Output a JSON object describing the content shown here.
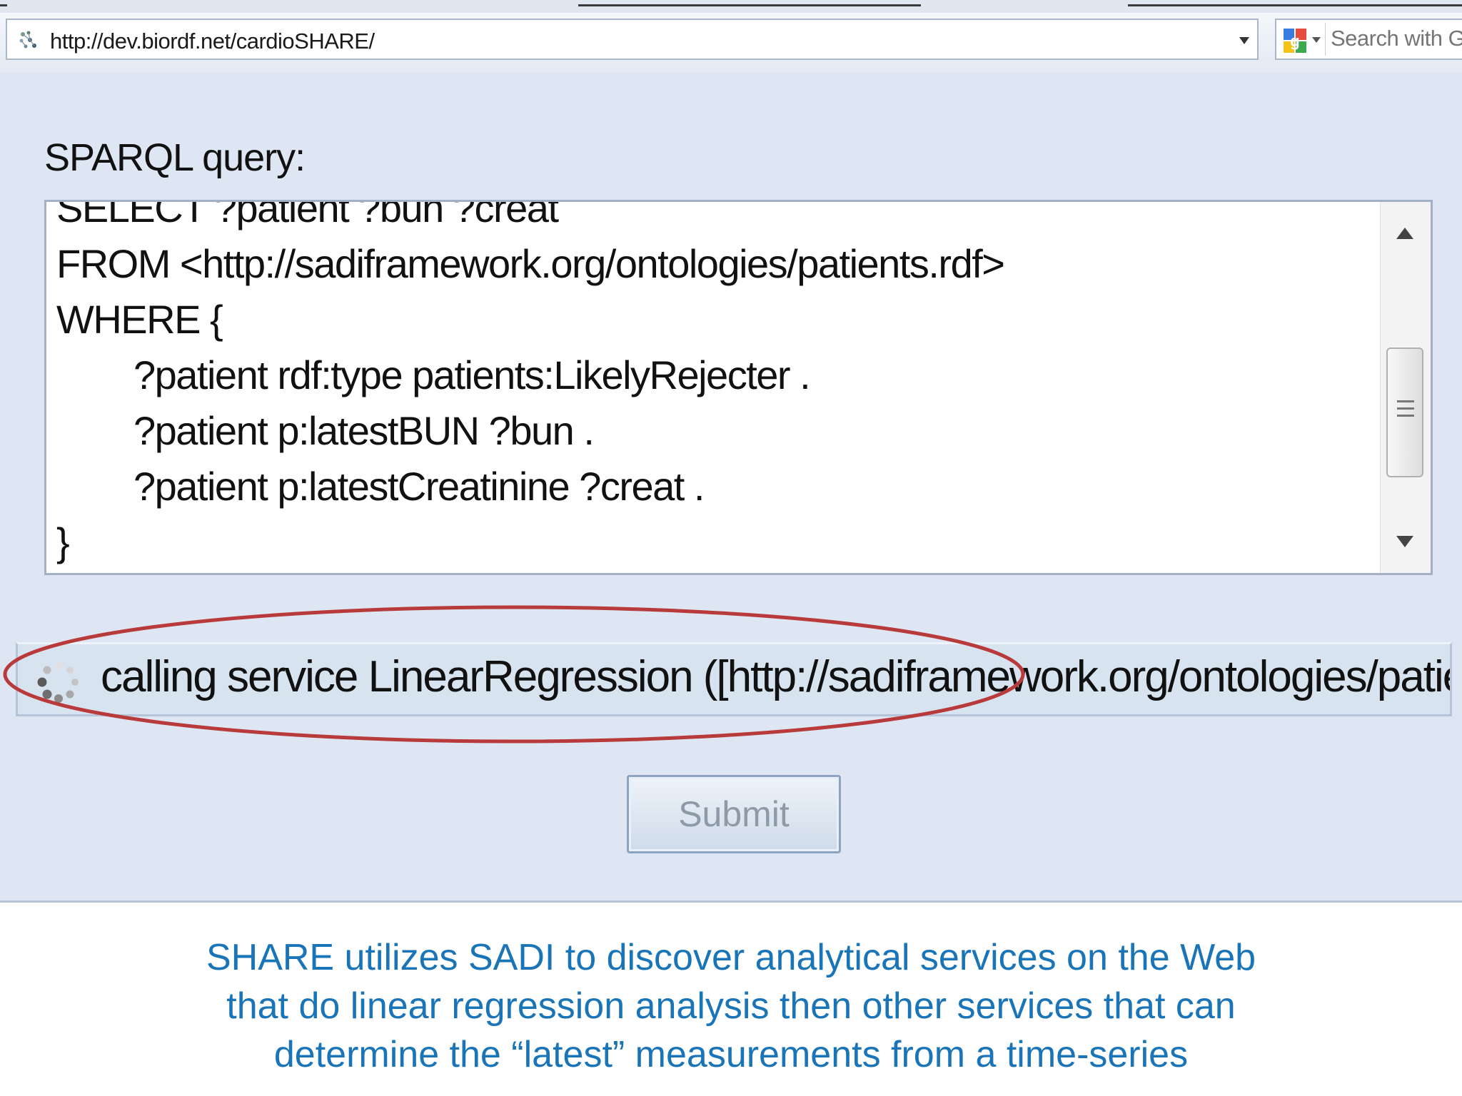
{
  "browser": {
    "url": "http://dev.biordf.net/cardioSHARE/",
    "search_placeholder": "Search with Goo"
  },
  "form": {
    "query_label": "SPARQL query:",
    "query_lines": [
      "SELECT ?patient ?bun ?creat",
      "FROM <http://sadiframework.org/ontologies/patients.rdf>",
      "WHERE {",
      "?patient rdf:type patients:LikelyRejecter .",
      "?patient p:latestBUN ?bun .",
      "?patient p:latestCreatinine ?creat .",
      "}"
    ],
    "status_text": "calling service LinearRegression ([http://sadiframework.org/ontologies/patients.rdf",
    "submit_label": "Submit"
  },
  "caption": {
    "line1": "SHARE utilizes SADI to discover analytical services on the Web",
    "line2": "that do linear regression analysis then other services that can",
    "line3": "determine the “latest” measurements from a time-series"
  },
  "colors": {
    "caption": "#1a74b8",
    "highlight_ellipse": "#b83a3a",
    "panel_background": "#dde6f2"
  },
  "icons": [
    "site-favicon-icon",
    "dropdown-arrow-icon",
    "google-search-icon",
    "loading-spinner-icon",
    "scroll-up-arrow-icon",
    "scroll-down-arrow-icon"
  ]
}
